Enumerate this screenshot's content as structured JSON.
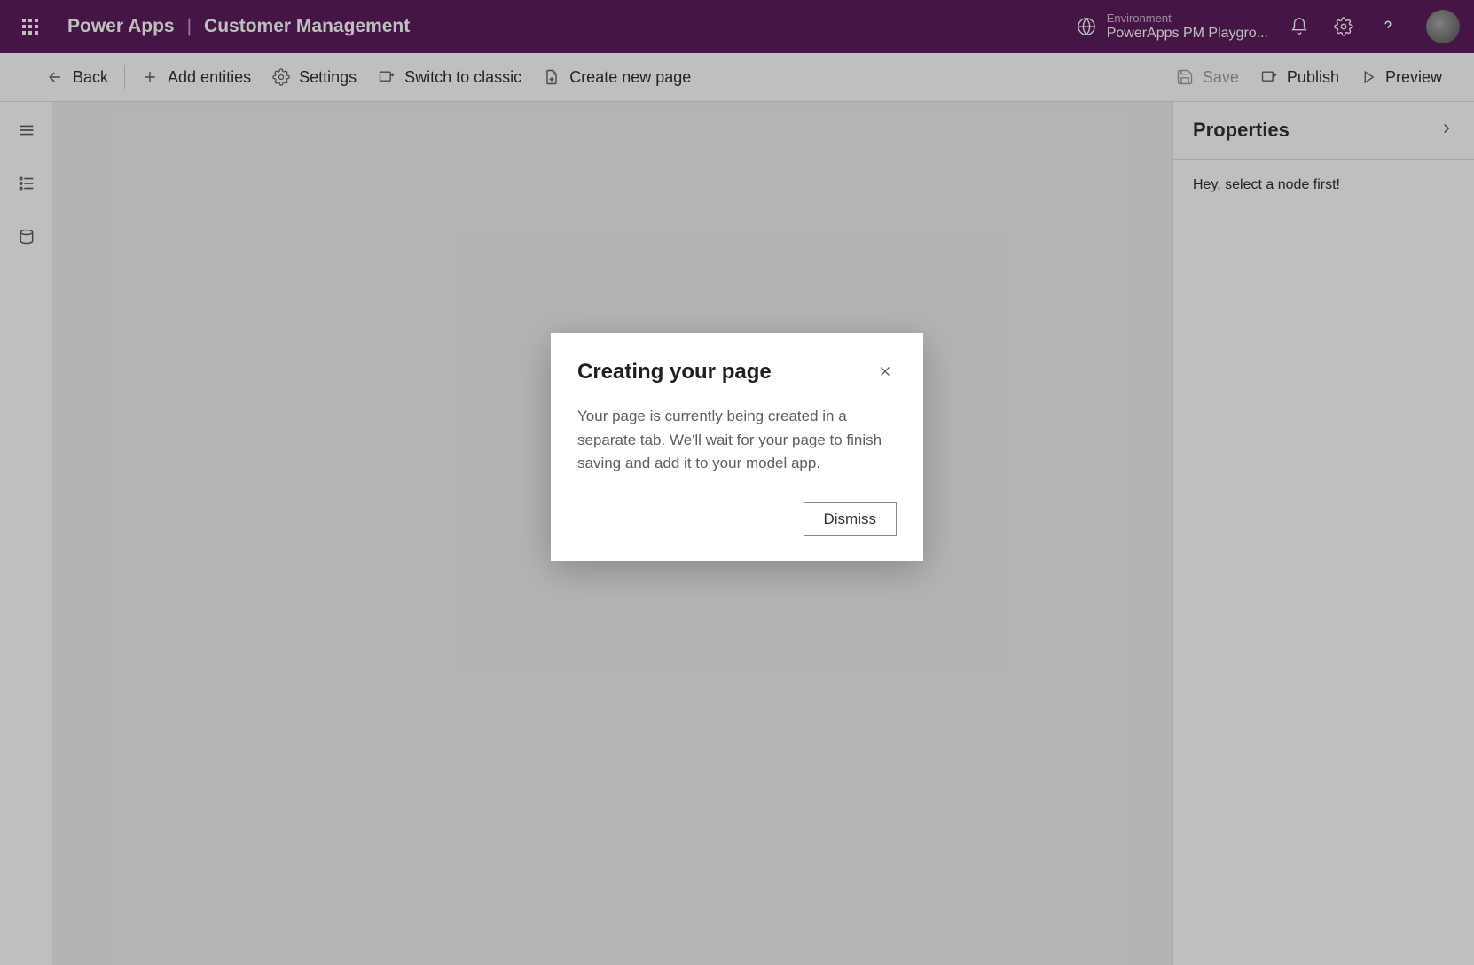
{
  "header": {
    "brand": "Power Apps",
    "divider": "|",
    "app_title": "Customer Management",
    "environment_label": "Environment",
    "environment_name": "PowerApps PM Playgro..."
  },
  "command_bar": {
    "back": "Back",
    "add_entities": "Add entities",
    "settings": "Settings",
    "switch_to_classic": "Switch to classic",
    "create_new_page": "Create new page",
    "save": "Save",
    "publish": "Publish",
    "preview": "Preview"
  },
  "properties": {
    "title": "Properties",
    "empty_hint": "Hey, select a node first!"
  },
  "dialog": {
    "title": "Creating your page",
    "body": "Your page is currently being created in a separate tab. We'll wait for your page to finish saving and add it to your model app.",
    "dismiss": "Dismiss"
  }
}
